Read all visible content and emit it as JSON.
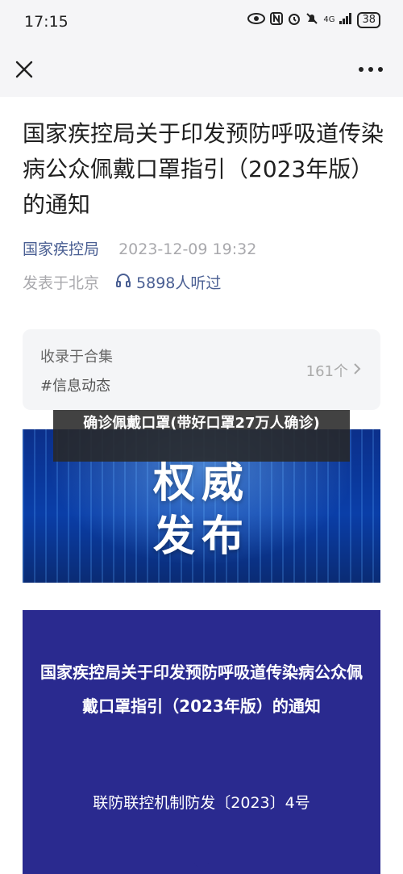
{
  "status_bar": {
    "time": "17:15",
    "signal_label": "4G",
    "battery": "38"
  },
  "icons": {
    "eye": "eye-icon",
    "nfc": "nfc-icon",
    "alarm": "alarm-icon",
    "mute": "mute-icon",
    "signal": "signal-icon",
    "battery": "battery-icon",
    "close": "close-icon",
    "more": "more-icon",
    "headphones": "headphones-icon",
    "chevron": "chevron-right-icon"
  },
  "article": {
    "title": "国家疾控局关于印发预防呼吸道传染病公众佩戴口罩指引（2023年版）的通知",
    "source": "国家疾控局",
    "date": "2023-12-09 19:32",
    "location": "发表于北京",
    "listen_count": "5898人听过"
  },
  "collection": {
    "label": "收录于合集",
    "tag": "#信息动态",
    "count": "161个"
  },
  "banner": {
    "line1": "权威",
    "line2": "发布"
  },
  "overlay_caption": "确诊佩戴口罩(带好口罩27万人确诊)",
  "document": {
    "title": "国家疾控局关于印发预防呼吸道传染病公众佩戴口罩指引（2023年版）的通知",
    "number": "联防联控机制防发〔2023〕4号"
  },
  "colors": {
    "source_blue": "#4a5f93",
    "doc_card_blue": "#2a2a8f",
    "banner_blue": "#0a3ea8"
  }
}
